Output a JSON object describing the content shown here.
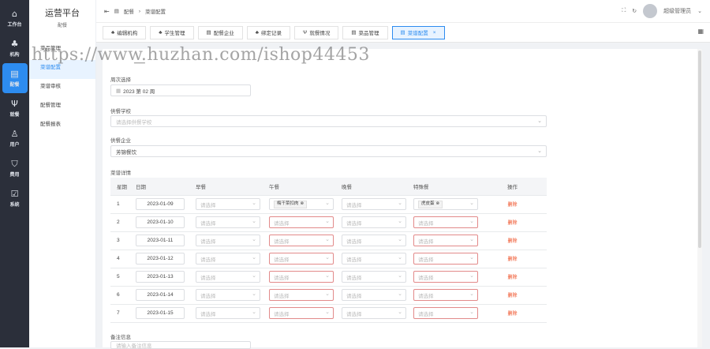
{
  "rail": [
    {
      "icon": "home-icon",
      "glyph": "⌂",
      "label": "工作台"
    },
    {
      "icon": "org-icon",
      "glyph": "♣",
      "label": "机构"
    },
    {
      "icon": "document-icon",
      "glyph": "▤",
      "label": "配餐"
    },
    {
      "icon": "dining-icon",
      "glyph": "Ψ",
      "label": "就餐"
    },
    {
      "icon": "user-icon",
      "glyph": "♙",
      "label": "用户"
    },
    {
      "icon": "shield-icon",
      "glyph": "⛉",
      "label": "费用"
    },
    {
      "icon": "settings-icon",
      "glyph": "☑",
      "label": "系统"
    }
  ],
  "sidebar": {
    "title": "运营平台",
    "subtitle": "配餐",
    "items": [
      "菜品管理",
      "菜谱配置",
      "菜谱审核",
      "配餐管理",
      "配餐报表"
    ]
  },
  "topbar": {
    "breadcrumb": [
      "配餐",
      "菜谱配置"
    ],
    "user": "超级管理员"
  },
  "tabs": [
    {
      "icon": "org-icon",
      "label": "编辑机构"
    },
    {
      "icon": "org-icon",
      "label": "学生管理"
    },
    {
      "icon": "document-icon",
      "label": "配餐企业"
    },
    {
      "icon": "org-icon",
      "label": "绑定记录"
    },
    {
      "icon": "dining-icon",
      "label": "就餐情况"
    },
    {
      "icon": "document-icon",
      "label": "菜品管理"
    },
    {
      "icon": "document-icon",
      "label": "菜谱配置"
    }
  ],
  "watermark": "https://www.huzhan.com/ishop44453",
  "form": {
    "week_label": "周次选择",
    "week_value": "2023 第 02 周",
    "school_label": "供餐学校",
    "school_placeholder": "请选择供餐学校",
    "company_label": "供餐企业",
    "company_value": "芳锦餐饮",
    "detail_label": "菜谱详情",
    "remark_label": "备注信息",
    "remark_placeholder": "请输入备注信息"
  },
  "table": {
    "headers": [
      "星期",
      "日期",
      "早餐",
      "午餐",
      "晚餐",
      "特殊餐",
      "操作"
    ],
    "placeholder": "请选择",
    "delete": "删除",
    "rows": [
      {
        "day": "1",
        "date": "2023-01-09",
        "lunch": "梅干菜扣肉",
        "special": "虎皮蛋"
      },
      {
        "day": "2",
        "date": "2023-01-10",
        "lunch": "",
        "special": ""
      },
      {
        "day": "3",
        "date": "2023-01-11",
        "lunch": "",
        "special": ""
      },
      {
        "day": "4",
        "date": "2023-01-12",
        "lunch": "",
        "special": ""
      },
      {
        "day": "5",
        "date": "2023-01-13",
        "lunch": "",
        "special": ""
      },
      {
        "day": "6",
        "date": "2023-01-14",
        "lunch": "",
        "special": ""
      },
      {
        "day": "7",
        "date": "2023-01-15",
        "lunch": "",
        "special": ""
      }
    ]
  }
}
